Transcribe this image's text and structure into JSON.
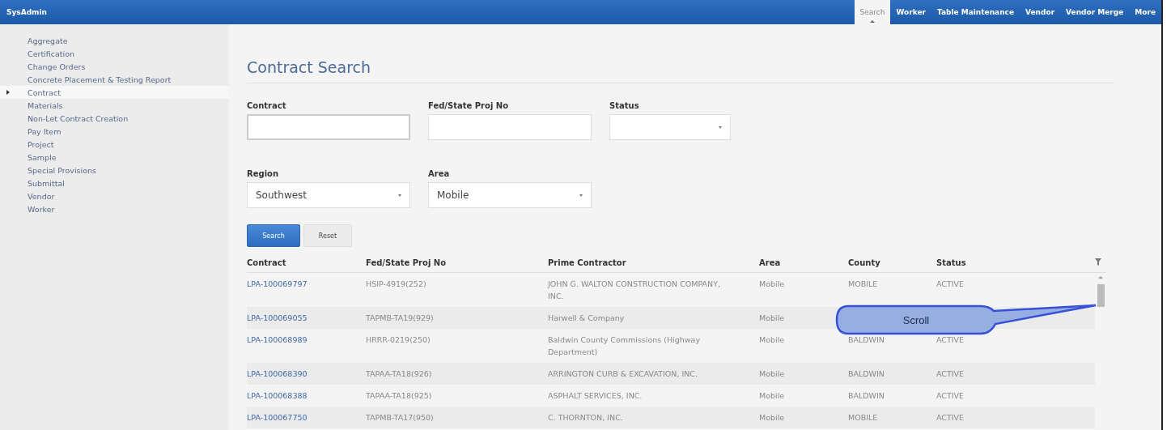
{
  "app_bar": {
    "title": "SysAdmin",
    "tabs": [
      {
        "label": "Search",
        "selected": true
      },
      {
        "label": "Worker",
        "selected": false
      },
      {
        "label": "Table Maintenance",
        "selected": false
      },
      {
        "label": "Vendor",
        "selected": false
      },
      {
        "label": "Vendor Merge",
        "selected": false
      },
      {
        "label": "More",
        "selected": false
      }
    ]
  },
  "sidebar": {
    "items": [
      {
        "label": "Aggregate",
        "selected": false
      },
      {
        "label": "Certification",
        "selected": false
      },
      {
        "label": "Change Orders",
        "selected": false
      },
      {
        "label": "Concrete Placement & Testing Report",
        "selected": false
      },
      {
        "label": "Contract",
        "selected": true
      },
      {
        "label": "Materials",
        "selected": false
      },
      {
        "label": "Non-Let Contract Creation",
        "selected": false
      },
      {
        "label": "Pay Item",
        "selected": false
      },
      {
        "label": "Project",
        "selected": false
      },
      {
        "label": "Sample",
        "selected": false
      },
      {
        "label": "Special Provisions",
        "selected": false
      },
      {
        "label": "Submittal",
        "selected": false
      },
      {
        "label": "Vendor",
        "selected": false
      },
      {
        "label": "Worker",
        "selected": false
      }
    ]
  },
  "page_title": "Contract Search",
  "filter_rows": [
    [
      {
        "kind": "text",
        "label": "Contract"
      },
      {
        "kind": "text",
        "label": "Fed/State Proj No"
      },
      {
        "kind": "select",
        "label": "Status"
      }
    ],
    [
      {
        "kind": "select",
        "label": "Region",
        "value": "Southwest"
      },
      {
        "kind": "select",
        "label": "Area",
        "value": "Mobile"
      }
    ]
  ],
  "buttons": [
    {
      "label": "Search",
      "kind": "primary"
    },
    {
      "label": "Reset",
      "kind": "secondary"
    }
  ],
  "table": {
    "columns": [
      "Contract",
      "Fed/State Proj No",
      "Prime Contractor",
      "Area",
      "County",
      "Status"
    ],
    "rows": [
      [
        "LPA-100069797",
        "HSIP-4919(252)",
        "JOHN G. WALTON CONSTRUCTION COMPANY, INC.",
        "Mobile",
        "MOBILE",
        "ACTIVE"
      ],
      [
        "LPA-100069055",
        "TAPMB-TA19(929)",
        "Harwell & Company",
        "Mobile",
        "",
        ""
      ],
      [
        "LPA-100068989",
        "HRRR-0219(250)",
        "Baldwin County Commissions (Highway Department)",
        "Mobile",
        "BALDWIN",
        "ACTIVE"
      ],
      [
        "LPA-100068390",
        "TAPAA-TA18(926)",
        "ARRINGTON CURB & EXCAVATION, INC.",
        "Mobile",
        "BALDWIN",
        "ACTIVE"
      ],
      [
        "LPA-100068388",
        "TAPAA-TA18(925)",
        "ASPHALT SERVICES, INC.",
        "Mobile",
        "BALDWIN",
        "ACTIVE"
      ],
      [
        "LPA-100067750",
        "TAPMB-TA17(950)",
        "C. THORNTON, INC.",
        "Mobile",
        "MOBILE",
        "ACTIVE"
      ]
    ]
  },
  "callout": {
    "label": "Scroll"
  }
}
